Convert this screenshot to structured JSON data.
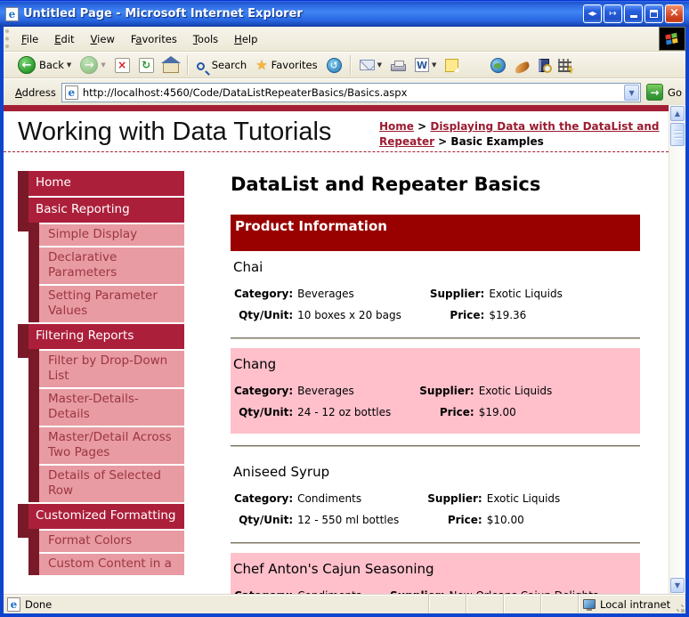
{
  "window": {
    "title": "Untitled Page - Microsoft Internet Explorer"
  },
  "menu_bar": {
    "items": [
      {
        "label": "File",
        "accel": 0
      },
      {
        "label": "Edit",
        "accel": 0
      },
      {
        "label": "View",
        "accel": 0
      },
      {
        "label": "Favorites",
        "accel": 1
      },
      {
        "label": "Tools",
        "accel": 0
      },
      {
        "label": "Help",
        "accel": 0
      }
    ]
  },
  "toolbar": {
    "back_label": "Back",
    "search_label": "Search",
    "favorites_label": "Favorites"
  },
  "address_bar": {
    "label": "Address",
    "url": "http://localhost:4560/Code/DataListRepeaterBasics/Basics.aspx",
    "go_label": "Go"
  },
  "icons": {
    "back_arrow": "←",
    "forward_arrow": "→",
    "stop_glyph": "×",
    "refresh_glyph": "↻",
    "history_glyph": "↺",
    "star_glyph": "★",
    "caret_down": "▼",
    "word_glyph": "W",
    "ie_glyph": "e",
    "close_glyph": "×",
    "switch_glyph": "◂▸",
    "popout_glyph": "↦",
    "scroll_up": "▲",
    "scroll_down": "▼"
  },
  "page": {
    "site_title": "Working with Data Tutorials",
    "breadcrumb": {
      "link1": "Home",
      "sep1": " > ",
      "link2": "Displaying Data with the DataList and Repeater",
      "sep2": " > ",
      "current": "Basic Examples"
    },
    "sidebar": {
      "items": [
        {
          "label": "Home",
          "level": 0
        },
        {
          "label": "Basic Reporting",
          "level": 0
        },
        {
          "label": "Simple Display",
          "level": 1
        },
        {
          "label": "Declarative Parameters",
          "level": 1
        },
        {
          "label": "Setting Parameter Values",
          "level": 1
        },
        {
          "label": "Filtering Reports",
          "level": 0
        },
        {
          "label": "Filter by Drop-Down List",
          "level": 1
        },
        {
          "label": "Master-Details-Details",
          "level": 1
        },
        {
          "label": "Master/Detail Across Two Pages",
          "level": 1
        },
        {
          "label": "Details of Selected Row",
          "level": 1
        },
        {
          "label": "Customized Formatting",
          "level": 0
        },
        {
          "label": "Format Colors",
          "level": 1
        },
        {
          "label": "Custom Content in a",
          "level": 1
        }
      ]
    },
    "main": {
      "heading": "DataList and Repeater Basics",
      "banner": "Product Information",
      "labels": {
        "category": "Category:",
        "supplier": "Supplier:",
        "qty": "Qty/Unit:",
        "price": "Price:"
      },
      "products": [
        {
          "name": "Chai",
          "category": "Beverages",
          "supplier": "Exotic Liquids",
          "qty": "10 boxes x 20 bags",
          "price": "$19.36"
        },
        {
          "name": "Chang",
          "category": "Beverages",
          "supplier": "Exotic Liquids",
          "qty": "24 - 12 oz bottles",
          "price": "$19.00"
        },
        {
          "name": "Aniseed Syrup",
          "category": "Condiments",
          "supplier": "Exotic Liquids",
          "qty": "12 - 550 ml bottles",
          "price": "$10.00"
        },
        {
          "name": "Chef Anton's Cajun Seasoning",
          "category": "Condiments",
          "supplier": "New Orleans Cajun Delights"
        }
      ]
    }
  },
  "status_bar": {
    "text": "Done",
    "zone": "Local intranet"
  },
  "colors": {
    "crimson_accent": "#AC1F3B",
    "dark_maroon": "#7A1A29",
    "menu_pink": "#E89BA2",
    "banner_maroon": "#990000",
    "item_pink": "#FFC0CB",
    "link_maroon": "#9B1B30",
    "titlebar_blue": "#2A64DC",
    "chrome_beige": "#EFEBDD"
  }
}
